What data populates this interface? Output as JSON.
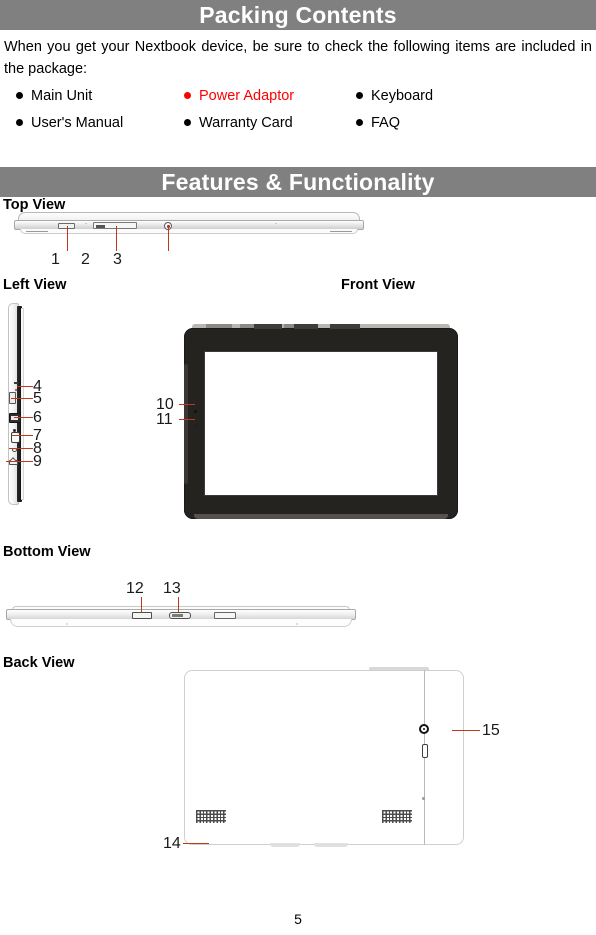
{
  "document": {
    "page_number": "5"
  },
  "sections": {
    "packing": {
      "title": "Packing Contents",
      "intro": "When you get your Nextbook device, be sure to check the following items are included in the package:",
      "items_row1": [
        {
          "label": "Main Unit",
          "color": "#000000"
        },
        {
          "label": "Power Adaptor",
          "color": "#ff0000"
        },
        {
          "label": "Keyboard",
          "color": "#000000"
        }
      ],
      "items_row2": [
        {
          "label": "User's Manual",
          "color": "#000000"
        },
        {
          "label": "Warranty Card",
          "color": "#000000"
        },
        {
          "label": "FAQ",
          "color": "#000000"
        }
      ]
    },
    "features": {
      "title": "Features & Functionality",
      "views": {
        "top": "Top View",
        "left": "Left View",
        "front": "Front View",
        "bottom": "Bottom View",
        "back": "Back View"
      },
      "callouts": {
        "top_view": [
          "1",
          "2",
          "3"
        ],
        "left_view": [
          "4",
          "5",
          "6",
          "7",
          "8",
          "9"
        ],
        "front_view": [
          "10",
          "11"
        ],
        "bottom_view": [
          "12",
          "13"
        ],
        "back_view": [
          "14",
          "15"
        ]
      }
    }
  },
  "colors": {
    "header_bar": "#808080",
    "header_text": "#ffffff",
    "accent_red": "#ff0000",
    "leader_line": "#c0381a",
    "body_text": "#000000",
    "bezel_dark": "#252320"
  }
}
